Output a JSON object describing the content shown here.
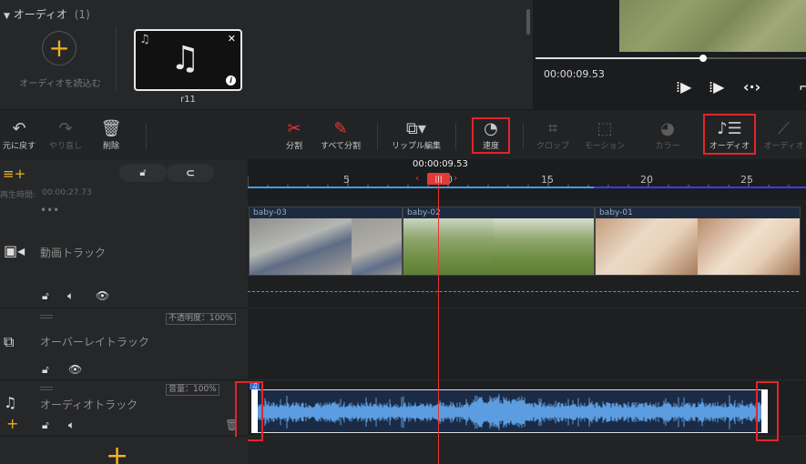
{
  "media_library": {
    "header": "オーディオ",
    "count": "(1)",
    "import_label": "オーディオを読込む",
    "item_name": "r11"
  },
  "preview": {
    "time": "00:00:09.53",
    "progress_fraction": 0.62
  },
  "toolbar": {
    "undo": "元に戻す",
    "redo": "やり直し",
    "delete": "削除",
    "split": "分割",
    "split_all": "すべて分割",
    "ripple_edit": "リップル編集",
    "speed": "速度",
    "crop": "クロップ",
    "motion": "モーション",
    "color": "カラー",
    "audio": "オーディオ",
    "audio_more": "オーディオ"
  },
  "timeline": {
    "duration_label": "再生時間:",
    "duration_value": "00:00:27.73",
    "playhead_time": "00:00:09.53",
    "ruler_ticks": [
      "5",
      "10",
      "15",
      "20",
      "25"
    ]
  },
  "tracks": {
    "video": {
      "name": "動画トラック",
      "clips": [
        "baby-03",
        "baby-02",
        "baby-01"
      ]
    },
    "overlay": {
      "name": "オーバーレイトラック",
      "opacity": "不透明度：100%"
    },
    "audio": {
      "name": "オーディオトラック",
      "volume": "音量：100%"
    }
  },
  "colors": {
    "accent_yellow": "#f2b01e",
    "highlight_red": "#e0262b",
    "playhead_red": "#e53935",
    "waveform_blue": "#5b9de0"
  }
}
